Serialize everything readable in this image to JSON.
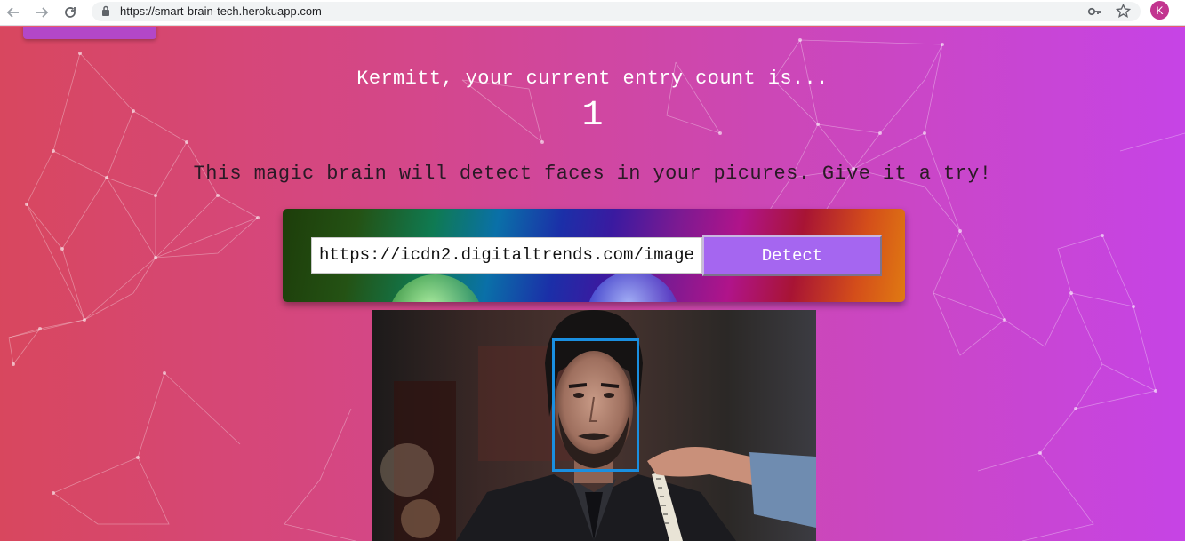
{
  "browser": {
    "url": "https://smart-brain-tech.herokuapp.com",
    "profile_initial": "K"
  },
  "rank": {
    "message": "Kermitt, your current entry count is...",
    "count": "1"
  },
  "tagline": "This magic brain will detect faces in your picures. Give it a try!",
  "form": {
    "input_value": "https://icdn2.digitaltrends.com/image",
    "button_label": "Detect"
  },
  "colors": {
    "face_box": "#1a8fe0",
    "detect_button": "#a566f0"
  }
}
